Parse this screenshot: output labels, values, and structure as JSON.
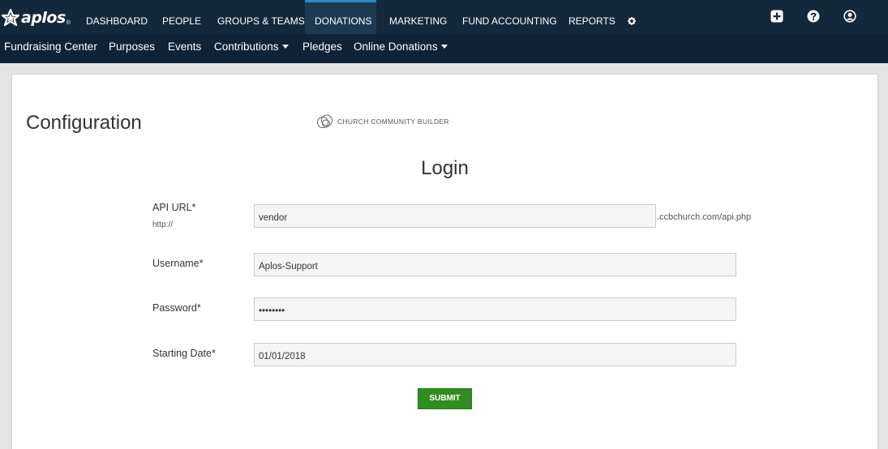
{
  "brand": {
    "name": "aplos",
    "reg": "®"
  },
  "topnav": {
    "items": [
      "DASHBOARD",
      "PEOPLE",
      "GROUPS & TEAMS",
      "DONATIONS",
      "MARKETING",
      "FUND ACCOUNTING",
      "REPORTS"
    ],
    "active": "DONATIONS",
    "icons": [
      "gear-icon",
      "plus-square-icon",
      "help-circle-icon",
      "user-circle-icon"
    ]
  },
  "subnav": {
    "items": [
      {
        "label": "Fundraising Center",
        "dropdown": false
      },
      {
        "label": "Purposes",
        "dropdown": false
      },
      {
        "label": "Events",
        "dropdown": false
      },
      {
        "label": "Contributions",
        "dropdown": true
      },
      {
        "label": "Pledges",
        "dropdown": false
      },
      {
        "label": "Online Donations",
        "dropdown": true
      }
    ]
  },
  "page": {
    "title": "Configuration",
    "partner_logo_text": "CHURCH COMMUNITY BUILDER"
  },
  "form": {
    "title": "Login",
    "api_url": {
      "label": "API URL*",
      "prefix": "http://",
      "value": "vendor",
      "suffix": ".ccbchurch.com/api.php"
    },
    "username": {
      "label": "Username*",
      "value": "Aplos-Support"
    },
    "password": {
      "label": "Password*",
      "value": "••••••••"
    },
    "starting_date": {
      "label": "Starting Date*",
      "value": "01/01/2018"
    },
    "submit_label": "SUBMIT"
  },
  "colors": {
    "topnav_bg": "#14283b",
    "subnav_bg": "#0f2236",
    "active_accent": "#2d86c5",
    "submit_green": "#2f8e1f"
  }
}
